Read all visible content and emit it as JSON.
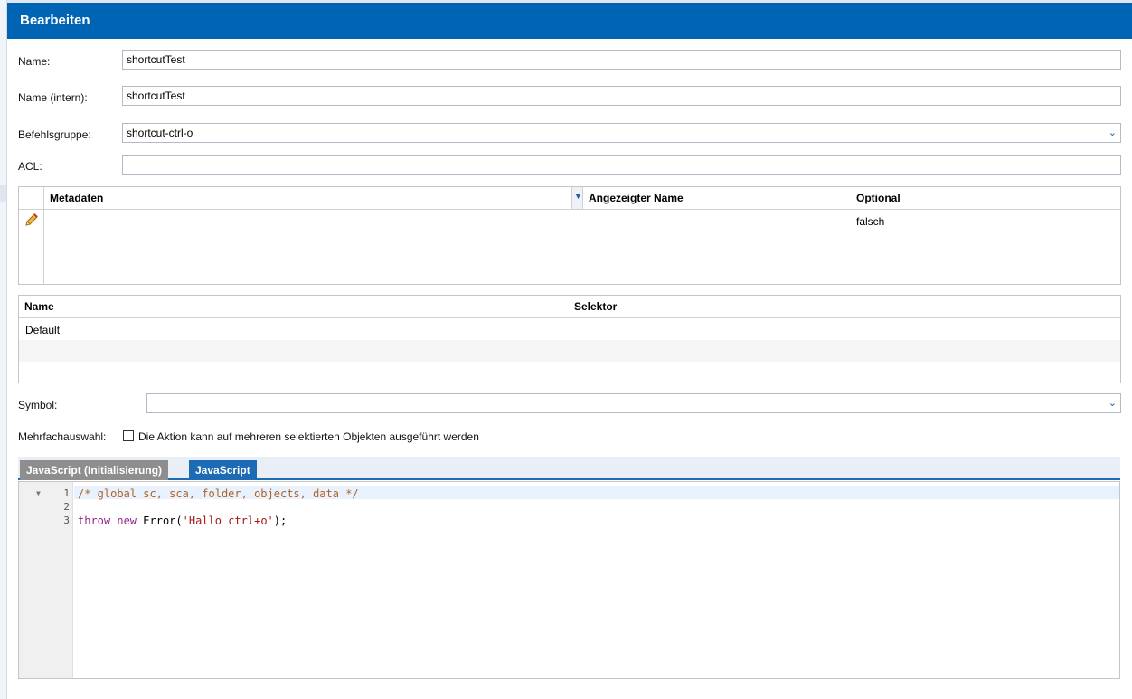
{
  "header": {
    "title": "Bearbeiten"
  },
  "form": {
    "name_label": "Name:",
    "name_value": "shortcutTest",
    "intern_label": "Name (intern):",
    "intern_value": "shortcutTest",
    "group_label": "Befehlsgruppe:",
    "group_value": "shortcut-ctrl-o",
    "acl_label": "ACL:",
    "acl_value": "",
    "symbol_label": "Symbol:",
    "symbol_value": "",
    "multi_label": "Mehrfachauswahl:",
    "multi_checkbox_label": "Die Aktion kann auf mehreren selektierten Objekten ausgeführt werden",
    "multi_checked": false
  },
  "metadata_grid": {
    "columns": [
      "Metadaten",
      "Angezeigter Name",
      "Optional"
    ],
    "rows": [
      {
        "metadaten": "",
        "angezeigter_name": "",
        "optional": "falsch"
      }
    ]
  },
  "selector_grid": {
    "columns": [
      "Name",
      "Selektor"
    ],
    "rows": [
      {
        "name": "Default",
        "selektor": ""
      }
    ]
  },
  "tabs": [
    {
      "label": "JavaScript (Initialisierung)",
      "active": false
    },
    {
      "label": "JavaScript",
      "active": true
    }
  ],
  "editor": {
    "line_numbers": [
      "1",
      "2",
      "3"
    ],
    "line1_comment": "/* global sc, sca, folder, objects, data */",
    "line3_kw1": "throw",
    "line3_kw2": "new",
    "line3_call": "Error(",
    "line3_str": "'Hallo ctrl+o'",
    "line3_end": ");"
  },
  "colors": {
    "header_bg": "#0064b4",
    "tab_active": "#1d6bb4",
    "tab_inactive": "#8e8e8e"
  },
  "icons": {
    "edit": "pencil-icon",
    "combo_arrow": "chevron-down-icon",
    "sort": "sort-desc-icon"
  }
}
